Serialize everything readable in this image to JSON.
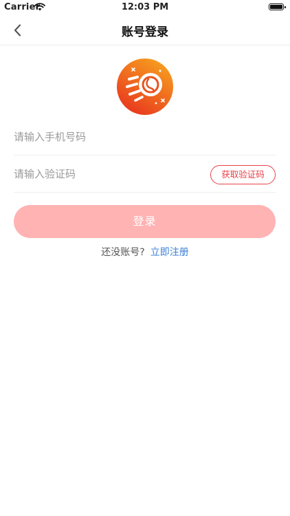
{
  "status_bar": {
    "carrier": "Carrier",
    "time": "12:03 PM"
  },
  "nav": {
    "title": "账号登录",
    "back_icon": "chevron-left-icon"
  },
  "logo": {
    "icon": "app-logo-bean-rocket",
    "gradient_start": "#f7a21f",
    "gradient_end": "#e8341e"
  },
  "form": {
    "phone_placeholder": "请输入手机号码",
    "phone_value": "",
    "code_placeholder": "请输入验证码",
    "code_value": "",
    "get_code_label": "获取验证码"
  },
  "login_button": {
    "label": "登录",
    "color": "#ffb3b3"
  },
  "register": {
    "prompt": "还没账号?",
    "link_label": "立即注册",
    "link_color": "#3a7fd5"
  },
  "colors": {
    "accent": "#e8414a",
    "divider": "#eeeeee"
  }
}
